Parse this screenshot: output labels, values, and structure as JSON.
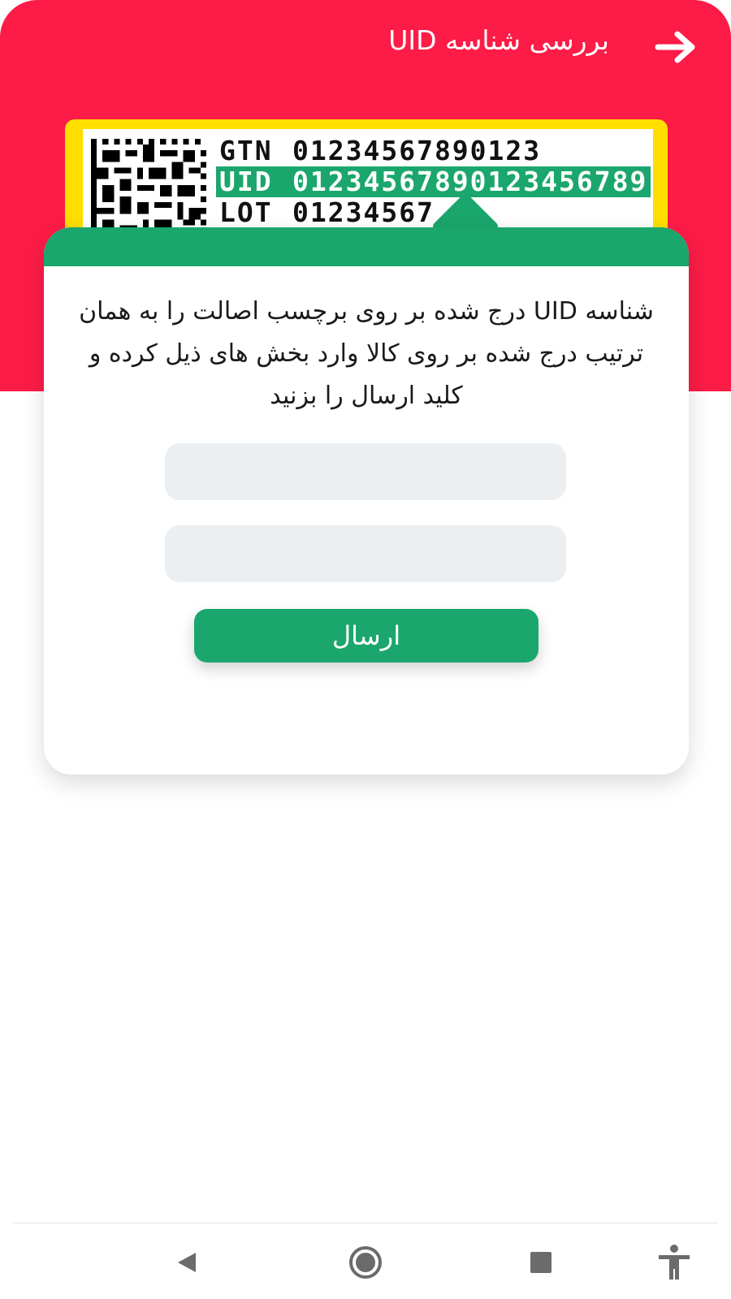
{
  "header": {
    "title": "بررسی شناسه UID",
    "background_color": "#fc1c47",
    "back_icon": "arrow-right-icon"
  },
  "label": {
    "gtn_key": "GTN",
    "gtn_value": "01234567890123",
    "uid_key": "UID",
    "uid_value": "01234567890123456789",
    "lot_key": "LOT",
    "lot_value": "01234567",
    "frame_color": "#ffde00",
    "highlight_color": "#1ba66d"
  },
  "card": {
    "instructions": "شناسه UID درج شده بر روی برچسب اصالت را به همان ترتیب درج شده بر روی کالا وارد بخش های ذیل کرده و کلید ارسال را بزنید",
    "field_1_value": "",
    "field_2_value": "",
    "submit_label": "ارسال",
    "accent_color": "#1ba66d"
  },
  "nav": {
    "back_icon": "triangle-back-icon",
    "home_icon": "circle-home-icon",
    "recents_icon": "square-recents-icon",
    "accessibility_icon": "accessibility-icon"
  }
}
